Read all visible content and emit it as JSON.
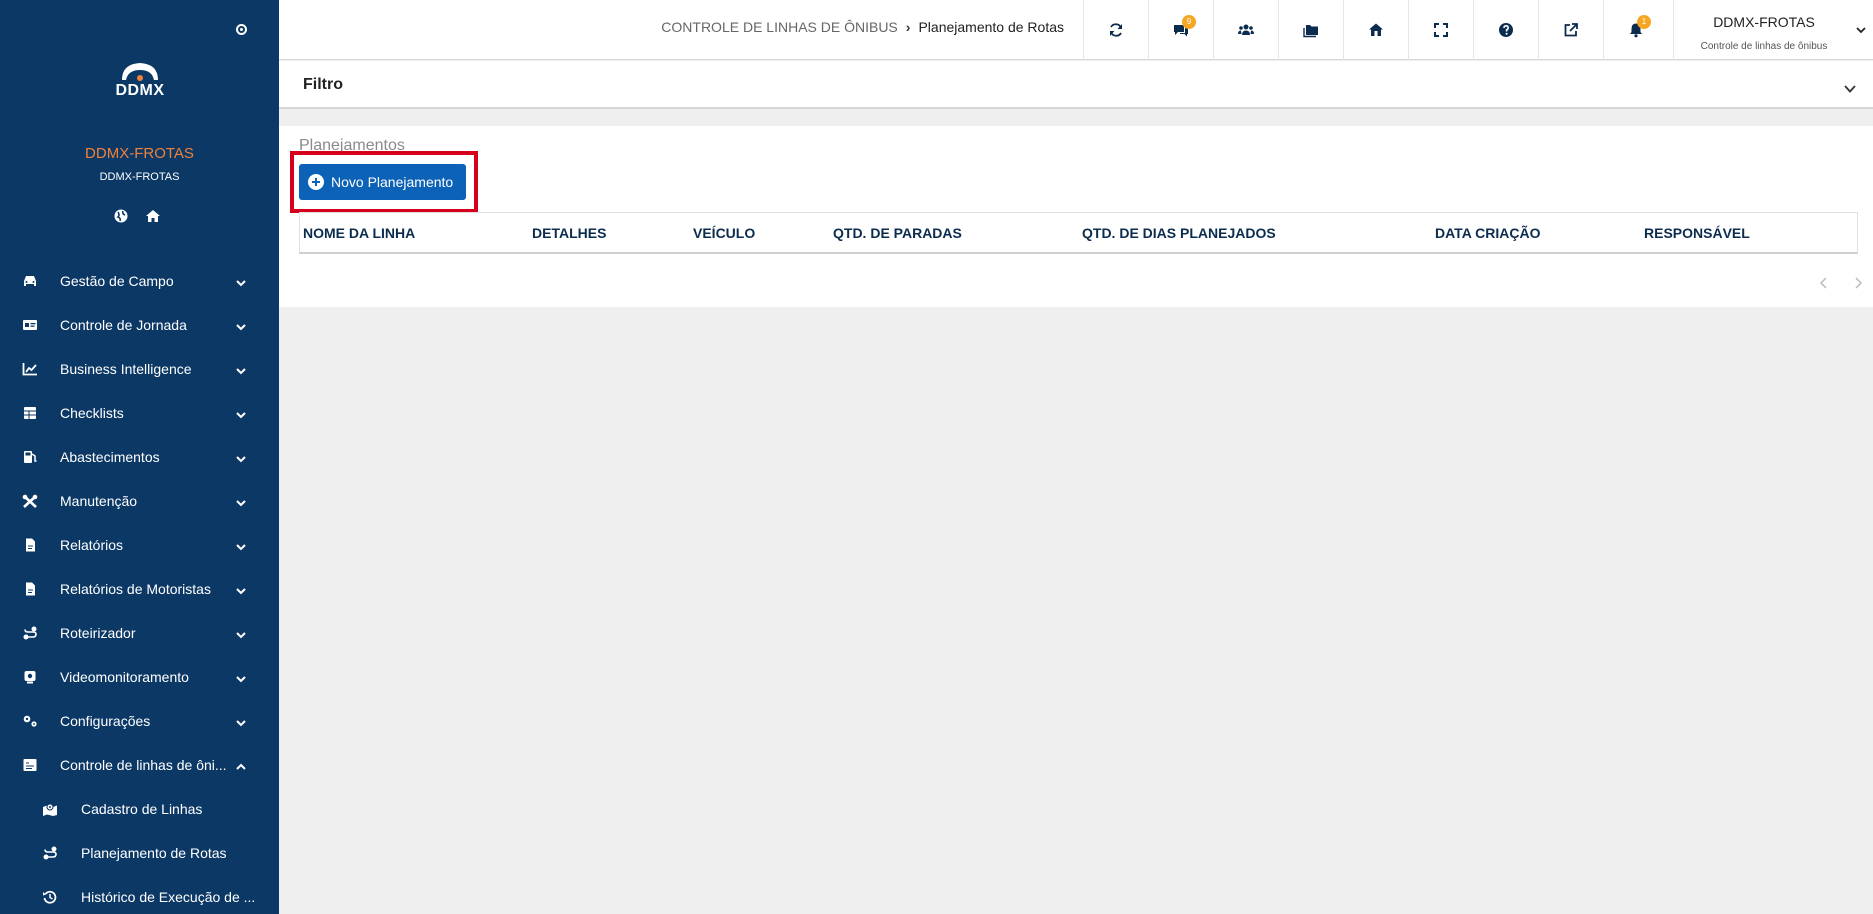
{
  "sidebar": {
    "logo_text": "DDMX",
    "company": "DDMX-FROTAS",
    "company_sub": "DDMX-FROTAS",
    "menu": [
      {
        "label": "Gestão de Campo",
        "icon": "car-icon"
      },
      {
        "label": "Controle de Jornada",
        "icon": "id-card-icon"
      },
      {
        "label": "Business Intelligence",
        "icon": "chart-line-icon"
      },
      {
        "label": "Checklists",
        "icon": "table-icon"
      },
      {
        "label": "Abastecimentos",
        "icon": "gas-pump-icon"
      },
      {
        "label": "Manutenção",
        "icon": "tools-icon"
      },
      {
        "label": "Relatórios",
        "icon": "file-icon"
      },
      {
        "label": "Relatórios de Motoristas",
        "icon": "file-icon"
      },
      {
        "label": "Roteirizador",
        "icon": "route-icon"
      },
      {
        "label": "Videomonitoramento",
        "icon": "camera-icon"
      },
      {
        "label": "Configurações",
        "icon": "cogs-icon"
      },
      {
        "label": "Controle de linhas de ôni...",
        "icon": "bus-doc-icon"
      }
    ],
    "submenu": [
      {
        "label": "Cadastro de Linhas",
        "icon": "map-marked-icon"
      },
      {
        "label": "Planejamento de Rotas",
        "icon": "route-icon"
      },
      {
        "label": "Histórico de Execução de ...",
        "icon": "history-icon"
      }
    ]
  },
  "topbar": {
    "breadcrumb_parent": "CONTROLE DE LINHAS DE ÔNIBUS",
    "breadcrumb_current": "Planejamento de Rotas",
    "messages_badge": "9",
    "notifications_badge": "1",
    "user_name": "DDMX-FROTAS",
    "user_sub": "Controle de linhas de ônibus"
  },
  "filter": {
    "label": "Filtro"
  },
  "panel": {
    "title": "Planejamentos",
    "new_button": "Novo Planejamento",
    "columns": [
      "NOME DA LINHA",
      "DETALHES",
      "VEÍCULO",
      "QTD. DE PARADAS",
      "QTD. DE DIAS PLANEJADOS",
      "DATA CRIAÇÃO",
      "RESPONSÁVEL"
    ]
  },
  "colors": {
    "sidebar": "#0c3866",
    "accent": "#0b62b6",
    "company": "#f0813a",
    "badge": "#f5a623",
    "highlight": "#d6001c"
  }
}
